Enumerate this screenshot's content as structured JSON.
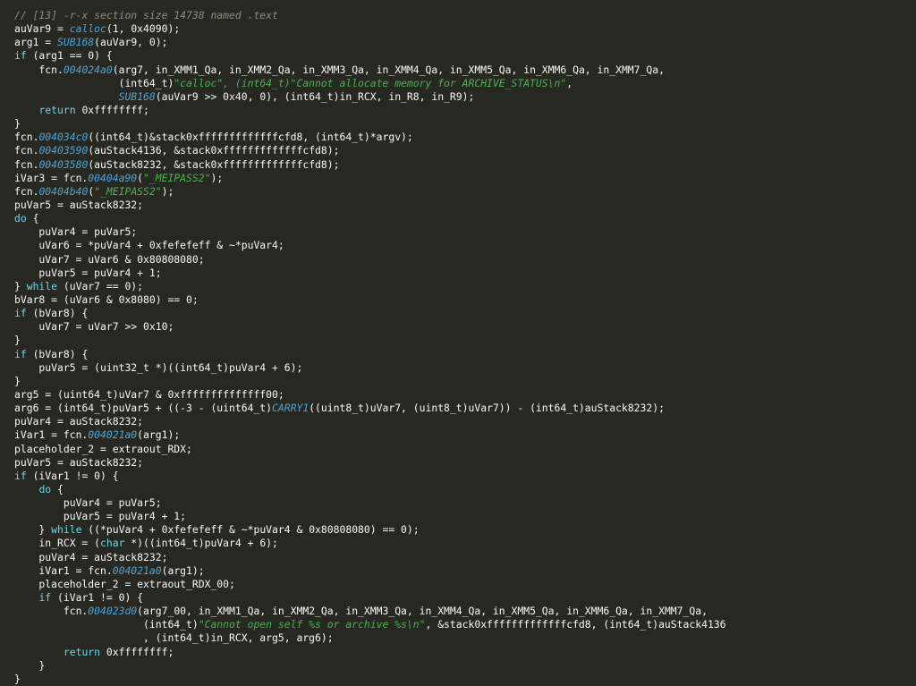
{
  "colors": {
    "background": "#272822",
    "text": "#f8f8f2",
    "keyword": "#66d9ef",
    "function": "#4ea3d6",
    "string": "#4caf50",
    "comment": "#8f8b7d"
  },
  "code": {
    "lines": [
      [
        {
          "t": "cm",
          "s": "// [13] -r-x section size 14738 named .text"
        }
      ],
      [
        {
          "t": "tx",
          "s": "auVar9 = "
        },
        {
          "t": "fn",
          "s": "calloc"
        },
        {
          "t": "tx",
          "s": "(1, 0x4090);"
        }
      ],
      [
        {
          "t": "tx",
          "s": "arg1 = "
        },
        {
          "t": "fn",
          "s": "SUB168"
        },
        {
          "t": "tx",
          "s": "(auVar9, 0);"
        }
      ],
      [
        {
          "t": "kw",
          "s": "if"
        },
        {
          "t": "tx",
          "s": " (arg1 == 0) {"
        }
      ],
      [
        {
          "t": "tx",
          "s": "    fcn."
        },
        {
          "t": "fn",
          "s": "004024a0"
        },
        {
          "t": "tx",
          "s": "(arg7, in_XMM1_Qa, in_XMM2_Qa, in_XMM3_Qa, in_XMM4_Qa, in_XMM5_Qa, in_XMM6_Qa, in_XMM7_Qa,"
        }
      ],
      [
        {
          "t": "tx",
          "s": "                 (int64_t)"
        },
        {
          "t": "str",
          "s": "\"calloc\", (int64_t)\"Cannot allocate memory for ARCHIVE_STATUS\\n\""
        },
        {
          "t": "tx",
          "s": ","
        }
      ],
      [
        {
          "t": "tx",
          "s": "                 "
        },
        {
          "t": "fn",
          "s": "SUB168"
        },
        {
          "t": "tx",
          "s": "(auVar9 >> 0x40, 0), (int64_t)in_RCX, in_R8, in_R9);"
        }
      ],
      [
        {
          "t": "tx",
          "s": "    "
        },
        {
          "t": "kw",
          "s": "return"
        },
        {
          "t": "tx",
          "s": " 0xffffffff;"
        }
      ],
      [
        {
          "t": "tx",
          "s": "}"
        }
      ],
      [
        {
          "t": "tx",
          "s": "fcn."
        },
        {
          "t": "fn",
          "s": "004034c0"
        },
        {
          "t": "tx",
          "s": "((int64_t)&stack0xfffffffffffffcfd8, (int64_t)*argv);"
        }
      ],
      [
        {
          "t": "tx",
          "s": "fcn."
        },
        {
          "t": "fn",
          "s": "00403590"
        },
        {
          "t": "tx",
          "s": "(auStack4136, &stack0xfffffffffffffcfd8);"
        }
      ],
      [
        {
          "t": "tx",
          "s": "fcn."
        },
        {
          "t": "fn",
          "s": "00403580"
        },
        {
          "t": "tx",
          "s": "(auStack8232, &stack0xfffffffffffffcfd8);"
        }
      ],
      [
        {
          "t": "tx",
          "s": "iVar3 = fcn."
        },
        {
          "t": "fn",
          "s": "00404a90"
        },
        {
          "t": "tx",
          "s": "("
        },
        {
          "t": "str",
          "s": "\"_MEIPASS2\""
        },
        {
          "t": "tx",
          "s": ");"
        }
      ],
      [
        {
          "t": "tx",
          "s": "fcn."
        },
        {
          "t": "fn",
          "s": "00404b40"
        },
        {
          "t": "tx",
          "s": "("
        },
        {
          "t": "str",
          "s": "\"_MEIPASS2\""
        },
        {
          "t": "tx",
          "s": ");"
        }
      ],
      [
        {
          "t": "tx",
          "s": "puVar5 = auStack8232;"
        }
      ],
      [
        {
          "t": "kw",
          "s": "do"
        },
        {
          "t": "tx",
          "s": " {"
        }
      ],
      [
        {
          "t": "tx",
          "s": "    puVar4 = puVar5;"
        }
      ],
      [
        {
          "t": "tx",
          "s": "    uVar6 = *puVar4 + 0xfefefeff & ~*puVar4;"
        }
      ],
      [
        {
          "t": "tx",
          "s": "    uVar7 = uVar6 & 0x80808080;"
        }
      ],
      [
        {
          "t": "tx",
          "s": "    puVar5 = puVar4 + 1;"
        }
      ],
      [
        {
          "t": "tx",
          "s": "} "
        },
        {
          "t": "kw",
          "s": "while"
        },
        {
          "t": "tx",
          "s": " (uVar7 == 0);"
        }
      ],
      [
        {
          "t": "tx",
          "s": "bVar8 = (uVar6 & 0x8080) == 0;"
        }
      ],
      [
        {
          "t": "kw",
          "s": "if"
        },
        {
          "t": "tx",
          "s": " (bVar8) {"
        }
      ],
      [
        {
          "t": "tx",
          "s": "    uVar7 = uVar7 >> 0x10;"
        }
      ],
      [
        {
          "t": "tx",
          "s": "}"
        }
      ],
      [
        {
          "t": "kw",
          "s": "if"
        },
        {
          "t": "tx",
          "s": " (bVar8) {"
        }
      ],
      [
        {
          "t": "tx",
          "s": "    puVar5 = (uint32_t *)((int64_t)puVar4 + 6);"
        }
      ],
      [
        {
          "t": "tx",
          "s": "}"
        }
      ],
      [
        {
          "t": "tx",
          "s": "arg5 = (uint64_t)uVar7 & 0xffffffffffffff00;"
        }
      ],
      [
        {
          "t": "tx",
          "s": "arg6 = (int64_t)puVar5 + ((-3 - (uint64_t)"
        },
        {
          "t": "fn",
          "s": "CARRY1"
        },
        {
          "t": "tx",
          "s": "((uint8_t)uVar7, (uint8_t)uVar7)) - (int64_t)auStack8232);"
        }
      ],
      [
        {
          "t": "tx",
          "s": "puVar4 = auStack8232;"
        }
      ],
      [
        {
          "t": "tx",
          "s": "iVar1 = fcn."
        },
        {
          "t": "fn",
          "s": "004021a0"
        },
        {
          "t": "tx",
          "s": "(arg1);"
        }
      ],
      [
        {
          "t": "tx",
          "s": "placeholder_2 = extraout_RDX;"
        }
      ],
      [
        {
          "t": "tx",
          "s": "puVar5 = auStack8232;"
        }
      ],
      [
        {
          "t": "kw",
          "s": "if"
        },
        {
          "t": "tx",
          "s": " (iVar1 != 0) {"
        }
      ],
      [
        {
          "t": "tx",
          "s": "    "
        },
        {
          "t": "kw",
          "s": "do"
        },
        {
          "t": "tx",
          "s": " {"
        }
      ],
      [
        {
          "t": "tx",
          "s": "        puVar4 = puVar5;"
        }
      ],
      [
        {
          "t": "tx",
          "s": "        puVar5 = puVar4 + 1;"
        }
      ],
      [
        {
          "t": "tx",
          "s": "    } "
        },
        {
          "t": "kw",
          "s": "while"
        },
        {
          "t": "tx",
          "s": " ((*puVar4 + 0xfefefeff & ~*puVar4 & 0x80808080) == 0);"
        }
      ],
      [
        {
          "t": "tx",
          "s": "    in_RCX = ("
        },
        {
          "t": "kw",
          "s": "char"
        },
        {
          "t": "tx",
          "s": " *)((int64_t)puVar4 + 6);"
        }
      ],
      [
        {
          "t": "tx",
          "s": "    puVar4 = auStack8232;"
        }
      ],
      [
        {
          "t": "tx",
          "s": "    iVar1 = fcn."
        },
        {
          "t": "fn",
          "s": "004021a0"
        },
        {
          "t": "tx",
          "s": "(arg1);"
        }
      ],
      [
        {
          "t": "tx",
          "s": "    placeholder_2 = extraout_RDX_00;"
        }
      ],
      [
        {
          "t": "tx",
          "s": "    "
        },
        {
          "t": "kw",
          "s": "if"
        },
        {
          "t": "tx",
          "s": " (iVar1 != 0) {"
        }
      ],
      [
        {
          "t": "tx",
          "s": "        fcn."
        },
        {
          "t": "fn",
          "s": "004023d0"
        },
        {
          "t": "tx",
          "s": "(arg7_00, in_XMM1_Qa, in_XMM2_Qa, in_XMM3_Qa, in_XMM4_Qa, in_XMM5_Qa, in_XMM6_Qa, in_XMM7_Qa,"
        }
      ],
      [
        {
          "t": "tx",
          "s": "                     (int64_t)"
        },
        {
          "t": "str",
          "s": "\"Cannot open self %s or archive %s\\n\""
        },
        {
          "t": "tx",
          "s": ", &stack0xfffffffffffffcfd8, (int64_t)auStack4136"
        }
      ],
      [
        {
          "t": "tx",
          "s": "                     , (int64_t)in_RCX, arg5, arg6);"
        }
      ],
      [
        {
          "t": "tx",
          "s": "        "
        },
        {
          "t": "kw",
          "s": "return"
        },
        {
          "t": "tx",
          "s": " 0xffffffff;"
        }
      ],
      [
        {
          "t": "tx",
          "s": "    }"
        }
      ],
      [
        {
          "t": "tx",
          "s": "}"
        }
      ]
    ]
  }
}
